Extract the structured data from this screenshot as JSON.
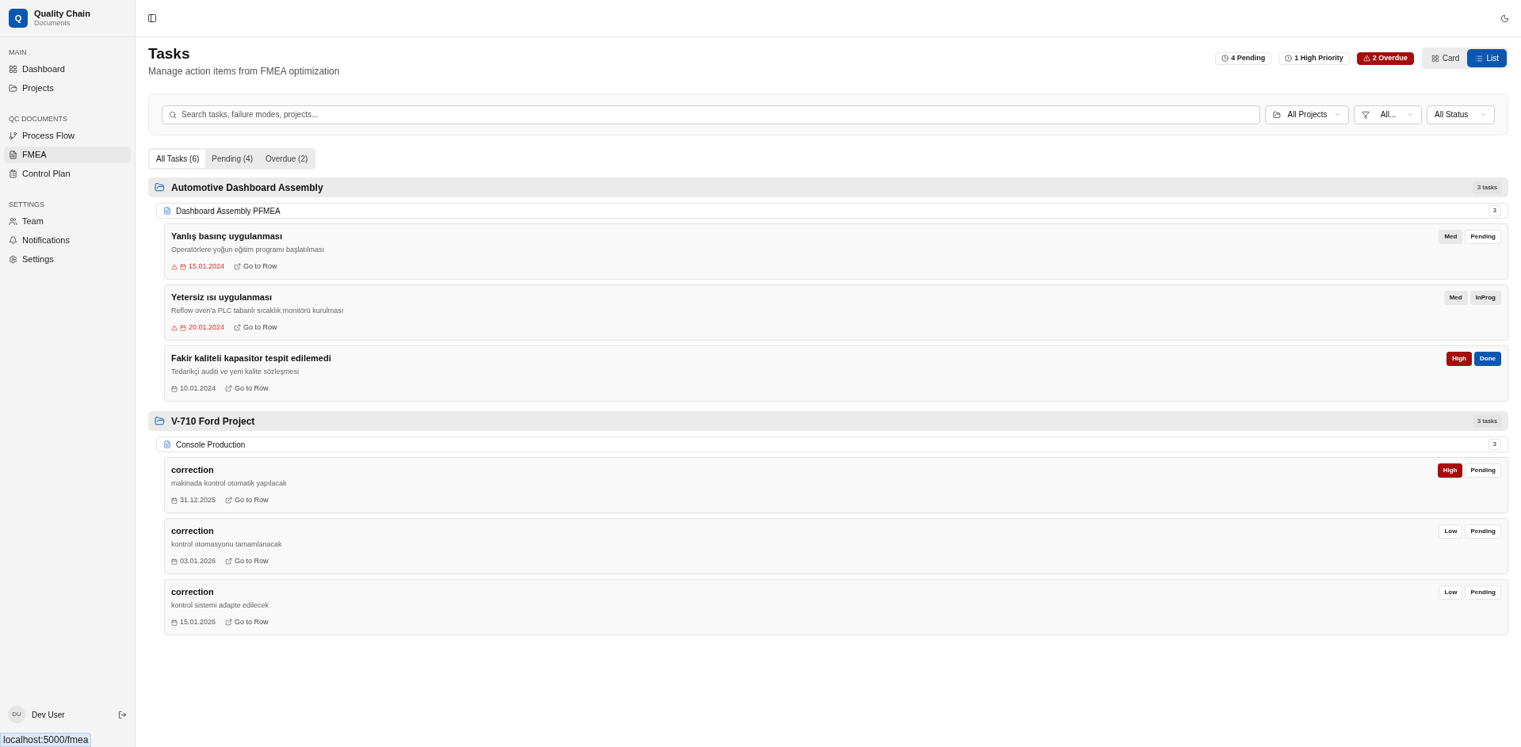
{
  "sidebar": {
    "brand": {
      "initial": "Q",
      "name": "Quality Chain",
      "subtitle": "Documents"
    },
    "sections": [
      {
        "title": "MAIN",
        "items": [
          {
            "label": "Dashboard",
            "selected": false
          },
          {
            "label": "Projects",
            "selected": false
          }
        ]
      },
      {
        "title": "QC DOCUMENTS",
        "items": [
          {
            "label": "Process Flow",
            "selected": false
          },
          {
            "label": "FMEA",
            "selected": true
          },
          {
            "label": "Control Plan",
            "selected": false
          }
        ]
      },
      {
        "title": "SETTINGS",
        "items": [
          {
            "label": "Team",
            "selected": false
          },
          {
            "label": "Notifications",
            "selected": false
          },
          {
            "label": "Settings",
            "selected": false
          }
        ]
      }
    ],
    "user": {
      "initials": "DU",
      "name": "Dev User"
    },
    "status_link": "localhost:5000/fmea"
  },
  "page": {
    "title": "Tasks",
    "subtitle": "Manage action items from FMEA optimization",
    "stats": [
      {
        "kind": "pending",
        "label": "4 Pending"
      },
      {
        "kind": "high",
        "label": "1 High Priority"
      },
      {
        "kind": "overdue",
        "label": "2 Overdue"
      }
    ],
    "view_toggle": [
      {
        "label": "Card",
        "selected": false
      },
      {
        "label": "List",
        "selected": true
      }
    ]
  },
  "filters": {
    "search_placeholder": "Search tasks, failure modes, projects...",
    "dropdowns": [
      {
        "value": "All Projects"
      },
      {
        "value": "All..."
      },
      {
        "value": "All Status"
      }
    ]
  },
  "tabs": [
    {
      "label": "All Tasks (6)",
      "selected": true
    },
    {
      "label": "Pending (4)",
      "selected": false
    },
    {
      "label": "Overdue (2)",
      "selected": false
    }
  ],
  "groups": [
    {
      "project": "Automotive Dashboard Assembly",
      "count": "3 tasks",
      "documents": [
        {
          "name": "Dashboard Assembly PFMEA",
          "count": "3",
          "tasks": [
            {
              "title": "Yanlış basınç uygulanması",
              "description": "Operatörlere yoğun eğitim programı başlatılması",
              "date": "15.01.2024",
              "overdue": true,
              "link": "Go to Row",
              "priority": {
                "kind": "med",
                "label": "Med"
              },
              "status": {
                "kind": "pending",
                "label": "Pending"
              }
            },
            {
              "title": "Yetersiz ısı uygulanması",
              "description": "Reflow oven'a PLC tabanlı sıcaklık monitörü kurulması",
              "date": "20.01.2024",
              "overdue": true,
              "link": "Go to Row",
              "priority": {
                "kind": "med",
                "label": "Med"
              },
              "status": {
                "kind": "inprog",
                "label": "InProg"
              }
            },
            {
              "title": "Fakir kaliteli kapasitor tespit edilemedi",
              "description": "Tedarikçi auditi ve yeni kalite sözleşmesi",
              "date": "10.01.2024",
              "overdue": false,
              "link": "Go to Row",
              "priority": {
                "kind": "high",
                "label": "High"
              },
              "status": {
                "kind": "done",
                "label": "Done"
              }
            }
          ]
        }
      ]
    },
    {
      "project": "V-710 Ford Project",
      "count": "3 tasks",
      "documents": [
        {
          "name": "Console Production",
          "count": "3",
          "tasks": [
            {
              "title": "correction",
              "description": "makinada kontrol otomatik yapılacak",
              "date": "31.12.2025",
              "overdue": false,
              "link": "Go to Row",
              "priority": {
                "kind": "high",
                "label": "High"
              },
              "status": {
                "kind": "pending",
                "label": "Pending"
              }
            },
            {
              "title": "correction",
              "description": "kontrol otomasyonu tamamlanacak",
              "date": "03.01.2026",
              "overdue": false,
              "link": "Go to Row",
              "priority": {
                "kind": "low",
                "label": "Low"
              },
              "status": {
                "kind": "pending",
                "label": "Pending"
              }
            },
            {
              "title": "correction",
              "description": "kontrol sistemi adapte edilecek",
              "date": "15.01.2026",
              "overdue": false,
              "link": "Go to Row",
              "priority": {
                "kind": "low",
                "label": "Low"
              },
              "status": {
                "kind": "pending",
                "label": "Pending"
              }
            }
          ]
        }
      ]
    }
  ]
}
